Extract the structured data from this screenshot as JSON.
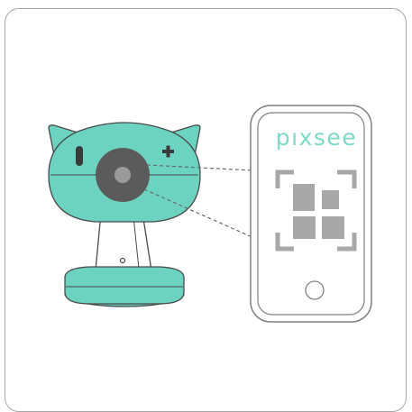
{
  "phone": {
    "brand": "pıxsee"
  },
  "colors": {
    "mint": "#6cd3c1",
    "mint_dark": "#5ec2b0",
    "lens": "#5b5b5b",
    "lens_center": "#9a9a9a",
    "outline": "#4a4a4a",
    "qr": "#a8a8a8",
    "phone_border": "#808080",
    "brand_text": "#7fd9c8"
  },
  "icons": {
    "camera": "baby-camera-icon",
    "phone": "smartphone-icon",
    "qr": "qr-code-icon"
  }
}
